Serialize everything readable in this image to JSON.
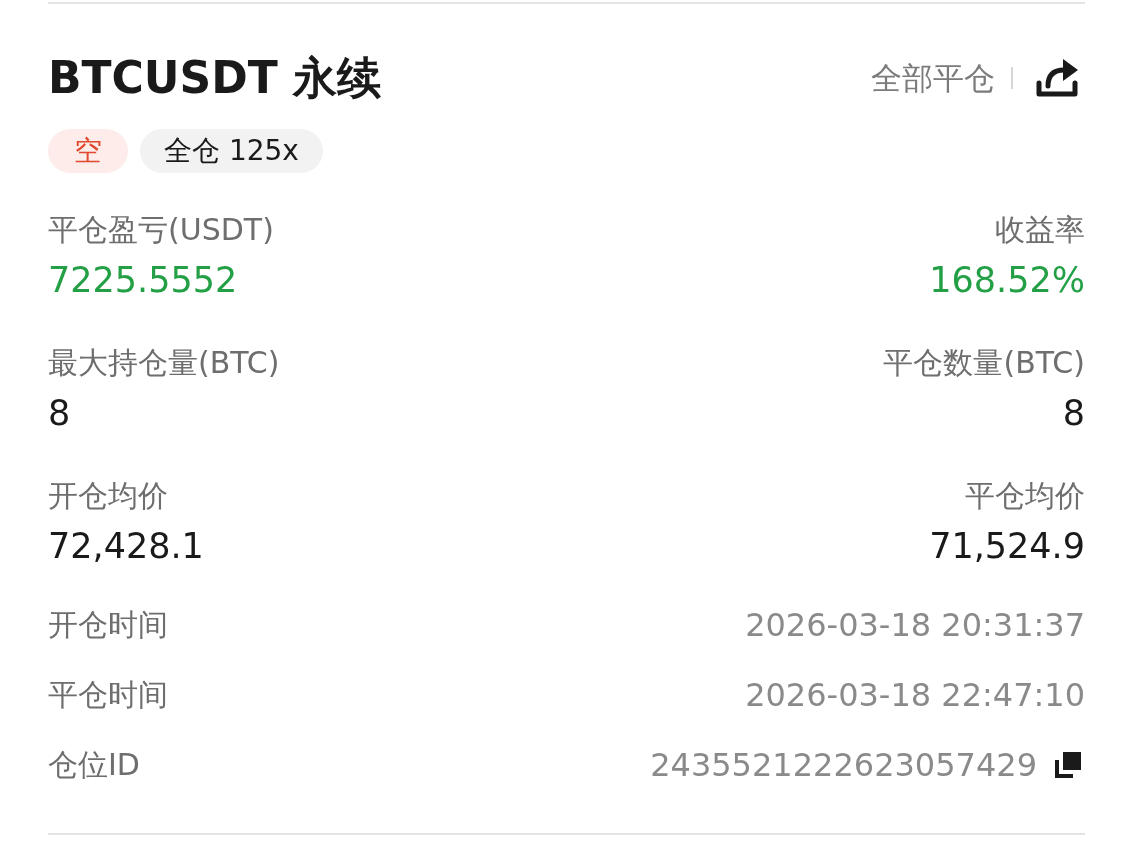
{
  "header": {
    "title": "BTCUSDT 永续",
    "close_all": "全部平仓"
  },
  "tags": [
    {
      "label": "空",
      "kind": "side"
    },
    {
      "label": "全仓 125x",
      "kind": "mode"
    }
  ],
  "stats": [
    {
      "label": "平仓盈亏(USDT)",
      "value": "7225.5552",
      "gain": true
    },
    {
      "label": "收益率",
      "value": "168.52%",
      "gain": true
    },
    {
      "label": "最大持仓量(BTC)",
      "value": "8",
      "gain": false
    },
    {
      "label": "平仓数量(BTC)",
      "value": "8",
      "gain": false
    },
    {
      "label": "开仓均价",
      "value": "72,428.1",
      "gain": false
    },
    {
      "label": "平仓均价",
      "value": "71,524.9",
      "gain": false
    }
  ],
  "details": [
    {
      "label": "开仓时间",
      "value": "2026-03-18 20:31:37",
      "copyable": false
    },
    {
      "label": "平仓时间",
      "value": "2026-03-18 22:47:10",
      "copyable": false
    },
    {
      "label": "仓位ID",
      "value": "2435521222623057429",
      "copyable": true
    }
  ]
}
